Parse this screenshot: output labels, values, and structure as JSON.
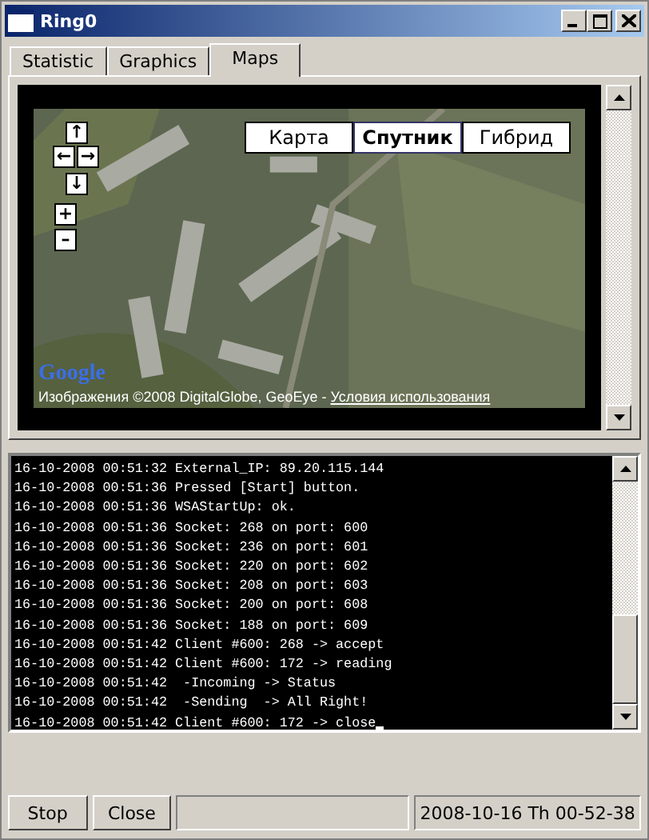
{
  "window": {
    "title": "Ring0"
  },
  "tabs": [
    {
      "label": "Statistic",
      "selected": false
    },
    {
      "label": "Graphics",
      "selected": false
    },
    {
      "label": "Maps",
      "selected": true
    }
  ],
  "map": {
    "nav": [
      "↑",
      "←",
      "→",
      "↓",
      "+",
      "–"
    ],
    "types": [
      {
        "label": "Карта",
        "selected": false
      },
      {
        "label": "Спутник",
        "selected": true
      },
      {
        "label": "Гибрид",
        "selected": false
      }
    ],
    "logo": "Google",
    "copyright": "Изображения ©2008 DigitalGlobe, GeoEye - ",
    "terms_link": "Условия использования"
  },
  "log": {
    "lines": [
      "16-10-2008 00:51:32 External_IP: 89.20.115.144",
      "16-10-2008 00:51:36 Pressed [Start] button.",
      "16-10-2008 00:51:36 WSAStartUp: ok.",
      "16-10-2008 00:51:36 Socket: 268 on port: 600",
      "16-10-2008 00:51:36 Socket: 236 on port: 601",
      "16-10-2008 00:51:36 Socket: 220 on port: 602",
      "16-10-2008 00:51:36 Socket: 208 on port: 603",
      "16-10-2008 00:51:36 Socket: 200 on port: 608",
      "16-10-2008 00:51:36 Socket: 188 on port: 609",
      "16-10-2008 00:51:42 Client #600: 268 -> accept",
      "16-10-2008 00:51:42 Client #600: 172 -> reading",
      "16-10-2008 00:51:42  -Incoming -> Status",
      "16-10-2008 00:51:42  -Sending  -> All Right!",
      "16-10-2008 00:51:42 Client #600: 172 -> close"
    ]
  },
  "buttons": [
    "Stop",
    "Close"
  ],
  "status_bar": {
    "datetime": "2008-10-16 Th 00-52-38"
  }
}
